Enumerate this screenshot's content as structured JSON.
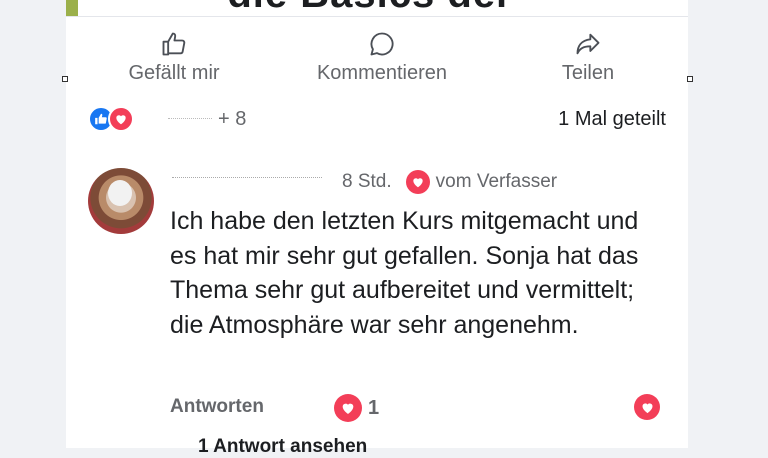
{
  "post": {
    "header_fragment": "die Basics der"
  },
  "action_bar": {
    "like": {
      "label": "Gefällt mir",
      "icon": "thumbs-up-icon"
    },
    "comment": {
      "label": "Kommentieren",
      "icon": "speech-bubble-icon"
    },
    "share": {
      "label": "Teilen",
      "icon": "share-arrow-icon"
    }
  },
  "reactions_summary": {
    "icons": [
      "like-icon",
      "love-icon"
    ],
    "more_count": "+ 8",
    "shares_text": "1 Mal geteilt"
  },
  "comment": {
    "time": "8 Std.",
    "author_badge": "vom Verfasser",
    "text": "Ich habe den letzten Kurs mitgemacht und es hat mir sehr gut gefallen. Sonja hat das Thema sehr gut aufbereitet und vermittelt; die Atmosphäre war sehr angenehm.",
    "reply_label": "Antworten",
    "reaction_count": "1",
    "view_replies": "1 Antwort ansehen"
  },
  "colors": {
    "accent_blue": "#1877f2",
    "love_red": "#f33e58",
    "secondary_text": "#65676b"
  }
}
